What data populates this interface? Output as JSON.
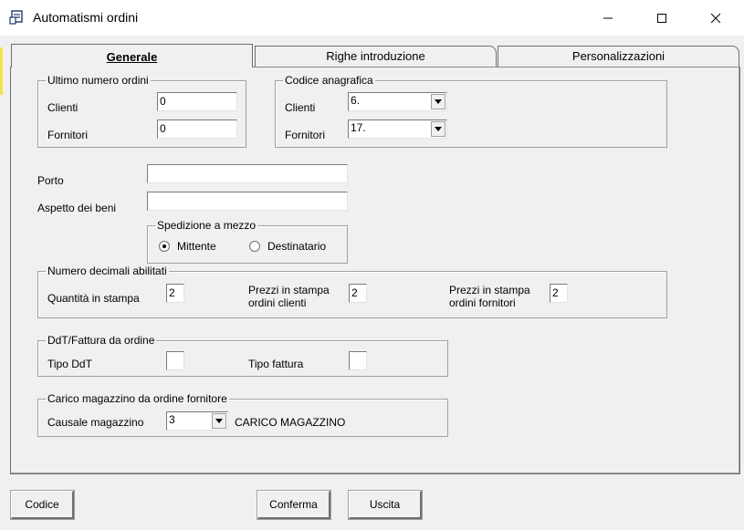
{
  "window": {
    "title": "Automatismi ordini",
    "icon": "document-window-icon"
  },
  "tabs": [
    {
      "label": "Generale",
      "active": true
    },
    {
      "label": "Righe introduzione",
      "active": false
    },
    {
      "label": "Personalizzazioni",
      "active": false
    }
  ],
  "ultimo_numero": {
    "legend": "Ultimo numero ordini",
    "clienti_label": "Clienti",
    "clienti_value": "0",
    "fornitori_label": "Fornitori",
    "fornitori_value": "0"
  },
  "codice_anagrafica": {
    "legend": "Codice anagrafica",
    "clienti_label": "Clienti",
    "clienti_value": "6.",
    "fornitori_label": "Fornitori",
    "fornitori_value": "17."
  },
  "porto": {
    "label": "Porto",
    "value": ""
  },
  "aspetto": {
    "label": "Aspetto dei beni",
    "value": ""
  },
  "spedizione": {
    "legend": "Spedizione a mezzo",
    "options": [
      "Mittente",
      "Destinatario"
    ],
    "selected": "Mittente"
  },
  "decimali": {
    "legend": "Numero decimali abilitati",
    "quantita_label": "Quantità in stampa",
    "quantita_value": "2",
    "prezzi_clienti_label_1": "Prezzi in stampa",
    "prezzi_clienti_label_2": "ordini clienti",
    "prezzi_clienti_value": "2",
    "prezzi_fornitori_label_1": "Prezzi in stampa",
    "prezzi_fornitori_label_2": "ordini fornitori",
    "prezzi_fornitori_value": "2"
  },
  "ddt": {
    "legend": "DdT/Fattura da ordine",
    "tipo_ddt_label": "Tipo DdT",
    "tipo_ddt_value": "",
    "tipo_fattura_label": "Tipo fattura",
    "tipo_fattura_value": ""
  },
  "carico": {
    "legend": "Carico magazzino da ordine fornitore",
    "causale_label": "Causale magazzino",
    "causale_value": "3",
    "causale_desc": "CARICO MAGAZZINO"
  },
  "buttons": {
    "codice": "Codice",
    "conferma": "Conferma",
    "uscita": "Uscita"
  }
}
